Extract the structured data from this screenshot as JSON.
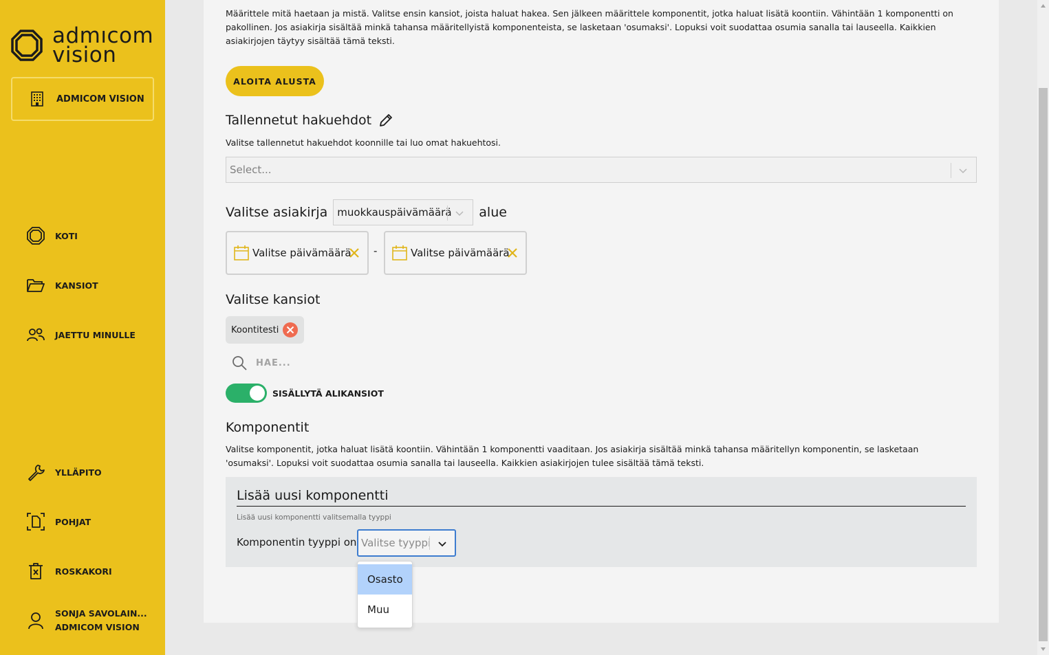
{
  "sidebar": {
    "logo": {
      "line1": "admıcom",
      "line2": "vision"
    },
    "org_button": "ADMICOM VISION",
    "items": [
      {
        "label": "KOTI",
        "icon": "home-icon"
      },
      {
        "label": "KANSIOT",
        "icon": "folder-icon"
      },
      {
        "label": "JAETTU MINULLE",
        "icon": "users-icon"
      },
      {
        "label": "YLLÄPITO",
        "icon": "wrench-icon"
      },
      {
        "label": "POHJAT",
        "icon": "template-icon"
      },
      {
        "label": "ROSKAKORI",
        "icon": "trash-icon"
      }
    ],
    "user": {
      "name": "SONJA SAVOLAIN...",
      "org": "ADMICOM VISION"
    },
    "accent": "#ebc11c"
  },
  "main": {
    "intro": "Määrittele mitä haetaan ja mistä. Valitse ensin kansiot, joista haluat hakea. Sen jälkeen määrittele komponentit, jotka haluat lisätä koontiin. Vähintään 1 komponentti on pakollinen. Jos asiakirja sisältää minkä tahansa määritellyistä komponenteista, se lasketaan 'osumaksi'. Lopuksi voit suodattaa osumia sanalla tai lauseella. Kaikkien asiakirjojen täytyy sisältää tämä teksti.",
    "restart_button": "ALOITA ALUSTA",
    "saved": {
      "title": "Tallennetut hakuehdot",
      "subtitle": "Valitse tallennetut hakuehdot koonnille tai luo omat hakuehtosi.",
      "placeholder": "Select..."
    },
    "document": {
      "label_before": "Valitse asiakirja",
      "selected": "muokkauspäivämäärä",
      "label_after": "alue",
      "start_date": "Valitse päivämäärä",
      "separator": "-",
      "end_date": "Valitse päivämäärä"
    },
    "folders": {
      "title": "Valitse kansiot",
      "chip": "Koontitesti",
      "search_placeholder": "HAE...",
      "toggle_label": "SISÄLLYTÄ ALIKANSIOT",
      "toggle_on": true
    },
    "components": {
      "title": "Komponentit",
      "description": "Valitse komponentit, jotka haluat lisätä koontiin. Vähintään 1 komponentti vaaditaan. Jos asiakirja sisältää minkä tahansa määritellyn komponentin, se lasketaan 'osumaksi'. Lopuksi voit suodattaa osumia sanalla tai lauseella. Kaikkien asiakirjojen tulee sisältää tämä teksti.",
      "panel_title": "Lisää uusi komponentti",
      "panel_hint": "Lisää uusi komponentti valitsemalla tyyppi",
      "type_label": "Komponentin tyyppi on:",
      "type_placeholder": "Valitse tyyppi",
      "options": [
        "Osasto",
        "Muu"
      ]
    }
  }
}
